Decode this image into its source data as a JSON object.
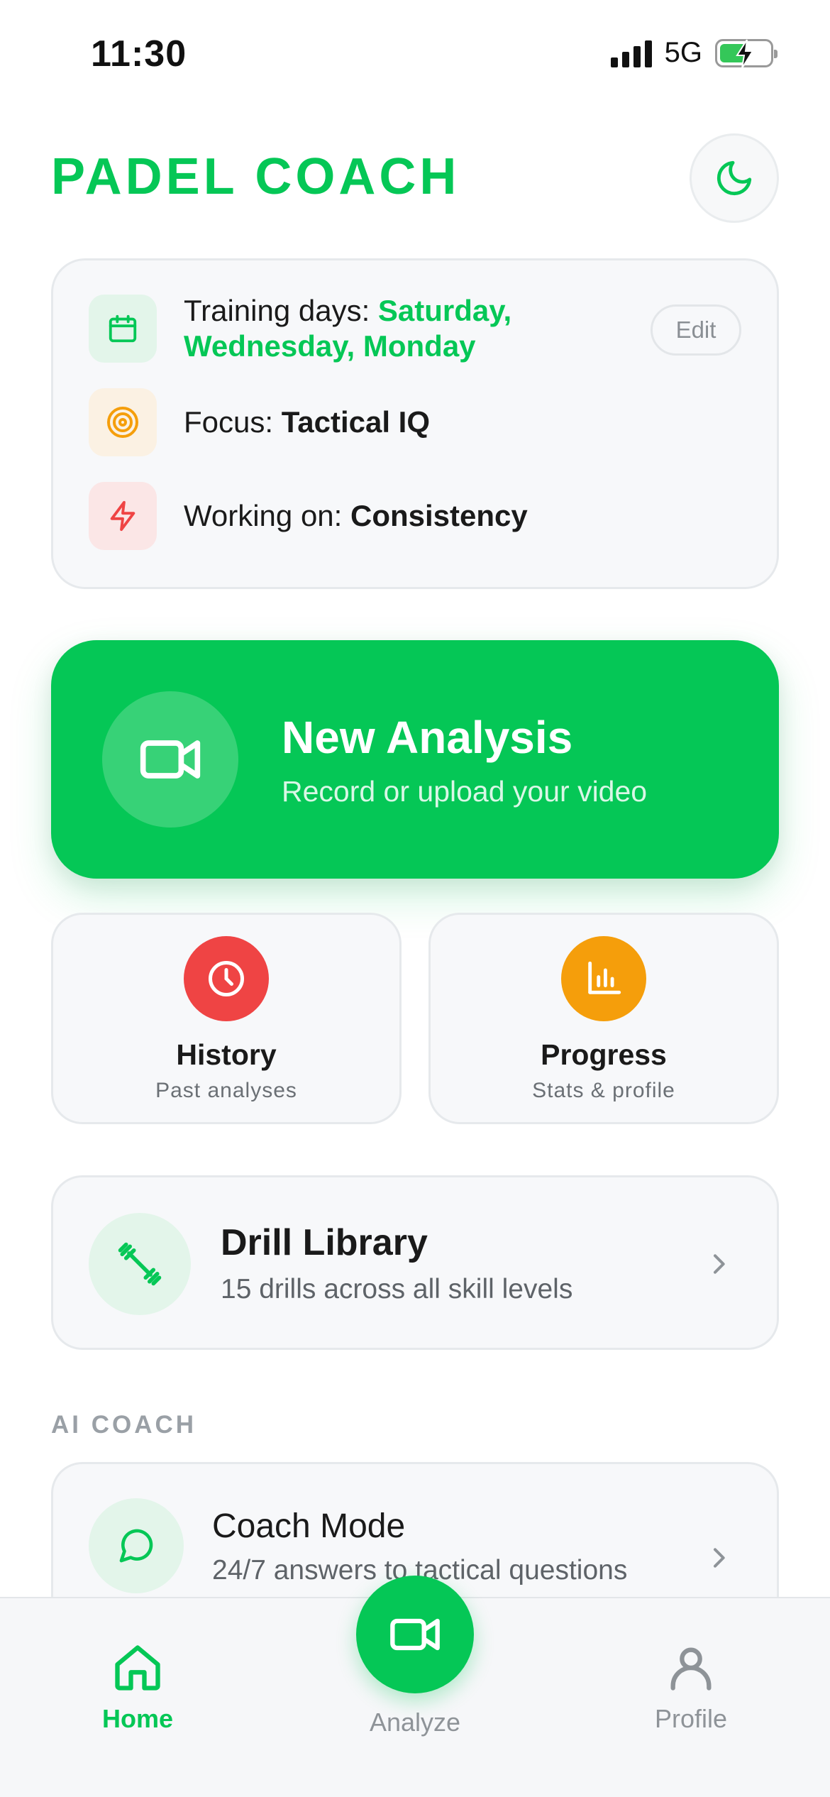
{
  "status_bar": {
    "time": "11:30",
    "network": "5G",
    "battery_level": 0.55
  },
  "header": {
    "title": "PADEL COACH",
    "theme_icon": "moon-icon"
  },
  "settings": {
    "training_label": "Training days: ",
    "training_days": "Saturday, Wednesday, Monday",
    "edit_label": "Edit",
    "focus_label": "Focus: ",
    "focus_value": "Tactical IQ",
    "working_label": "Working on: ",
    "working_value": "Consistency",
    "icons": [
      "calendar-icon",
      "target-icon",
      "lightning-icon"
    ]
  },
  "new_analysis": {
    "title": "New Analysis",
    "subtitle": "Record or upload your video",
    "icon": "video-camera-icon"
  },
  "tiles": [
    {
      "title": "History",
      "subtitle": "Past analyses",
      "icon": "clock-icon",
      "color": "#ef4444"
    },
    {
      "title": "Progress",
      "subtitle": "Stats & profile",
      "icon": "bar-chart-icon",
      "color": "#f59e0b"
    }
  ],
  "drill_library": {
    "title": "Drill Library",
    "subtitle": "15 drills across all skill levels",
    "icon": "dumbbell-icon"
  },
  "ai_coach": {
    "section_label": "AI COACH",
    "title": "Coach Mode",
    "subtitle": "24/7 answers to tactical questions",
    "icon": "chat-bubble-icon"
  },
  "tab_bar": {
    "items": [
      {
        "label": "Home",
        "icon": "home-icon",
        "active": true
      },
      {
        "label": "Analyze",
        "icon": "video-camera-icon",
        "active": false
      },
      {
        "label": "Profile",
        "icon": "user-icon",
        "active": false
      }
    ]
  },
  "colors": {
    "brand_green": "#05c756",
    "history_red": "#ef4444",
    "progress_orange": "#f59e0b",
    "inactive_gray": "#8e9398"
  }
}
